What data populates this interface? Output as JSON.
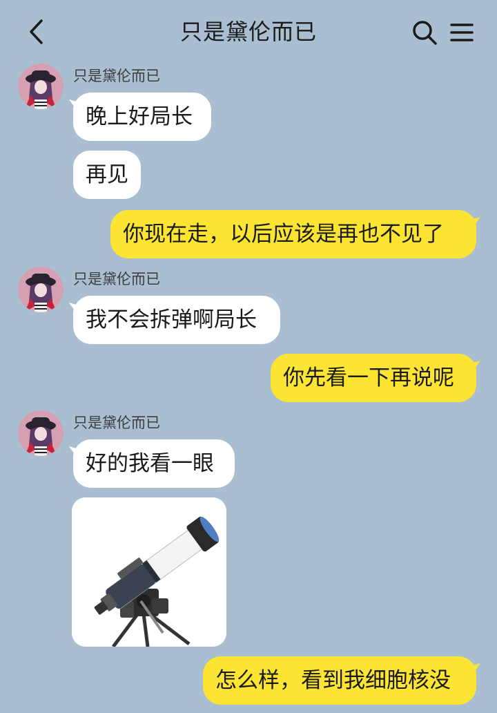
{
  "header": {
    "title": "只是黛伦而已"
  },
  "messages": [
    {
      "sender": "只是黛伦而已",
      "text": "晚上好局长"
    },
    {
      "text": "再见"
    },
    {
      "text": "你现在走，以后应该是再也不见了"
    },
    {
      "sender": "只是黛伦而已",
      "text": "我不会拆弹啊局长"
    },
    {
      "text": "你先看一下再说呢"
    },
    {
      "sender": "只是黛伦而已",
      "text": "好的我看一眼"
    },
    {
      "text": "怎么样，看到我细胞核没"
    }
  ],
  "colors": {
    "background": "#a9bfd1",
    "incoming_bubble": "#ffffff",
    "outgoing_bubble": "#fbe532"
  },
  "icons": [
    "back-arrow-icon",
    "search-icon",
    "menu-icon",
    "telescope-image"
  ]
}
